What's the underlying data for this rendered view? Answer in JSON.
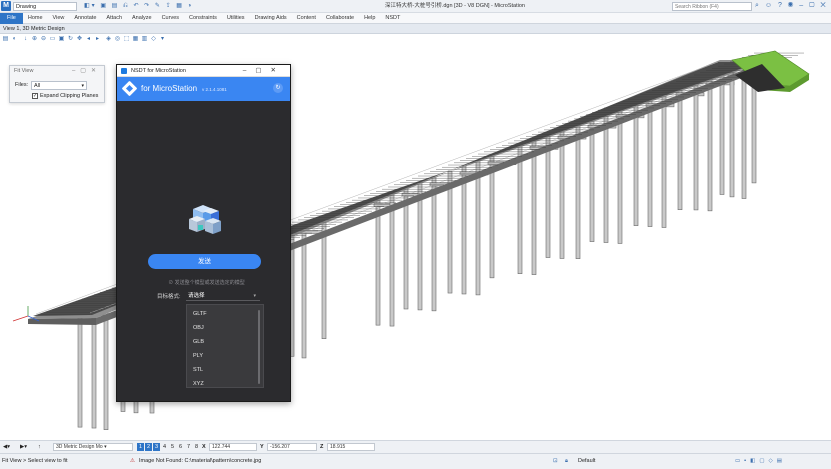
{
  "app": {
    "logo": "M",
    "workspace": "Drawing",
    "title": "深江特大桥-大桩号引桥.dgn [3D - V8 DGN] - MicroStation",
    "search_placeholder": "Search Ribbon (F4)"
  },
  "ribbon": {
    "tabs": [
      "File",
      "Home",
      "View",
      "Annotate",
      "Attach",
      "Analyze",
      "Curves",
      "Constraints",
      "Utilities",
      "Drawing Aids",
      "Content",
      "Collaborate",
      "Help",
      "NSDT"
    ],
    "active": "File"
  },
  "view": {
    "title": "View 1, 3D Metric Design"
  },
  "fit_view": {
    "title": "Fit View",
    "files_label": "Files:",
    "files_value": "All",
    "expand_label": "Expand Clipping Planes",
    "expand_checked": true
  },
  "nsdt": {
    "window_title": "NSDT for MicroStation",
    "brand": "for MicroStation",
    "version": "v 2.1.4.1081",
    "send_label": "发送",
    "hint": "⊘ 发送整个模型或发送选定的模型",
    "format_label": "目标格式:",
    "format_placeholder": "请选择",
    "formats": [
      "GLTF",
      "OBJ",
      "GLB",
      "PLY",
      "STL",
      "XYZ"
    ],
    "accent": "#3a86f2"
  },
  "view_controls": {
    "view_combo": "3D Metric Design Mo",
    "views": [
      "1",
      "2",
      "3",
      "4",
      "5",
      "6",
      "7",
      "8"
    ],
    "x_label": "X",
    "x_value": "122.744",
    "y_label": "Y",
    "y_value": "-156.207",
    "z_label": "Z",
    "z_value": "18.915"
  },
  "status": {
    "prompt": "Fit View > Select view to fit",
    "message": "Image Not Found: C:\\material\\pattern\\concrete.jpg",
    "level": "Default"
  }
}
